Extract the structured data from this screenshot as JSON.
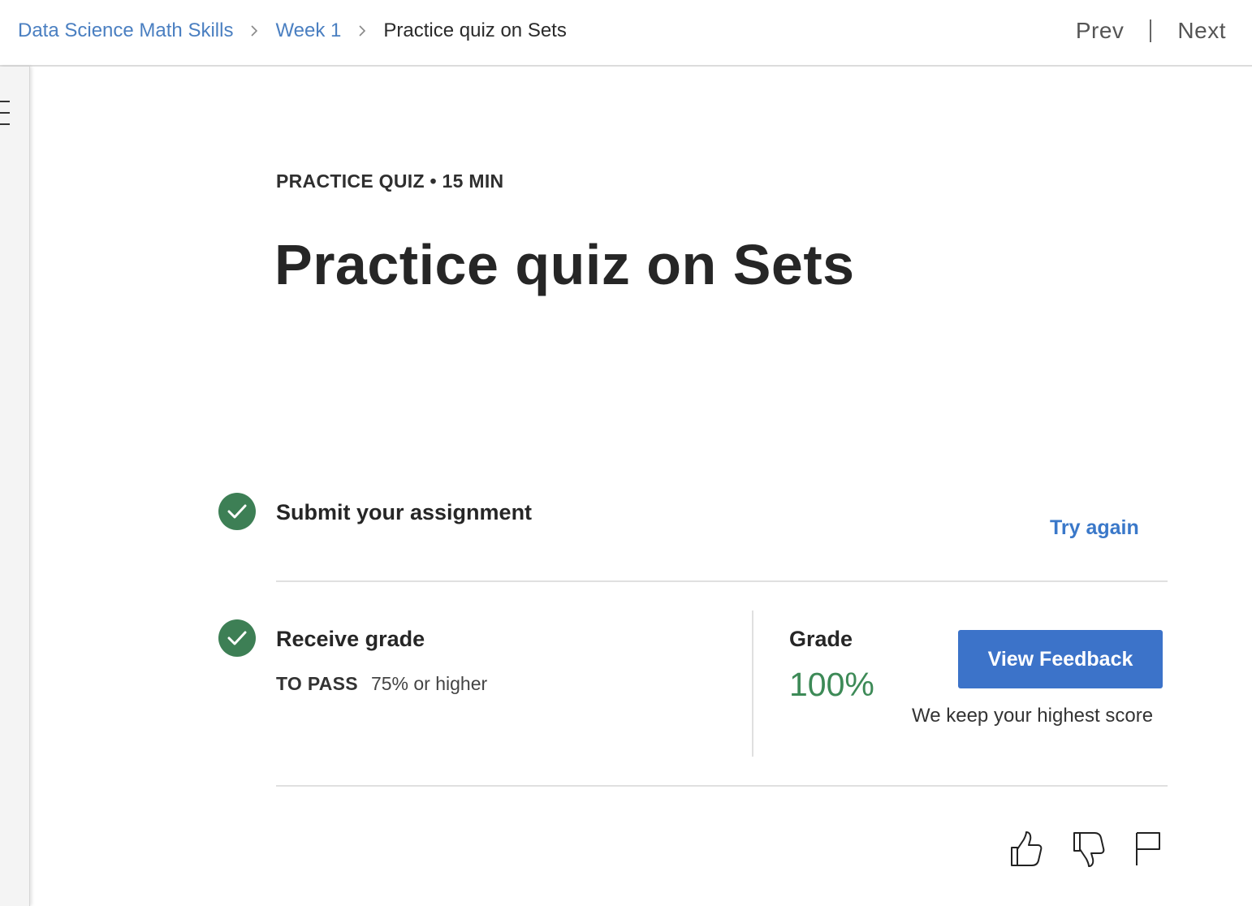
{
  "breadcrumb": {
    "items": [
      {
        "label": "Data Science Math Skills"
      },
      {
        "label": "Week 1"
      },
      {
        "label": "Practice quiz on Sets"
      }
    ]
  },
  "nav": {
    "prev_label": "Prev",
    "next_label": "Next"
  },
  "page": {
    "kicker": "PRACTICE QUIZ • 15 MIN",
    "title": "Practice quiz on Sets"
  },
  "steps": {
    "submit": {
      "title": "Submit your assignment",
      "action_label": "Try again"
    },
    "grade": {
      "title": "Receive grade",
      "pass_label": "TO PASS",
      "pass_value": "75% or higher",
      "grade_label": "Grade",
      "grade_value": "100%",
      "feedback_button": "View Feedback",
      "note": "We keep your highest score"
    }
  },
  "icons": {
    "menu": "menu-icon",
    "like": "thumbs-up-icon",
    "dislike": "thumbs-down-icon",
    "flag": "flag-icon",
    "check": "check-circle-icon",
    "separator": "chevron-right-icon"
  },
  "colors": {
    "link": "#4a7fc1",
    "accent": "#3c73c9",
    "success": "#3d7f55",
    "grade": "#3d8a57"
  }
}
